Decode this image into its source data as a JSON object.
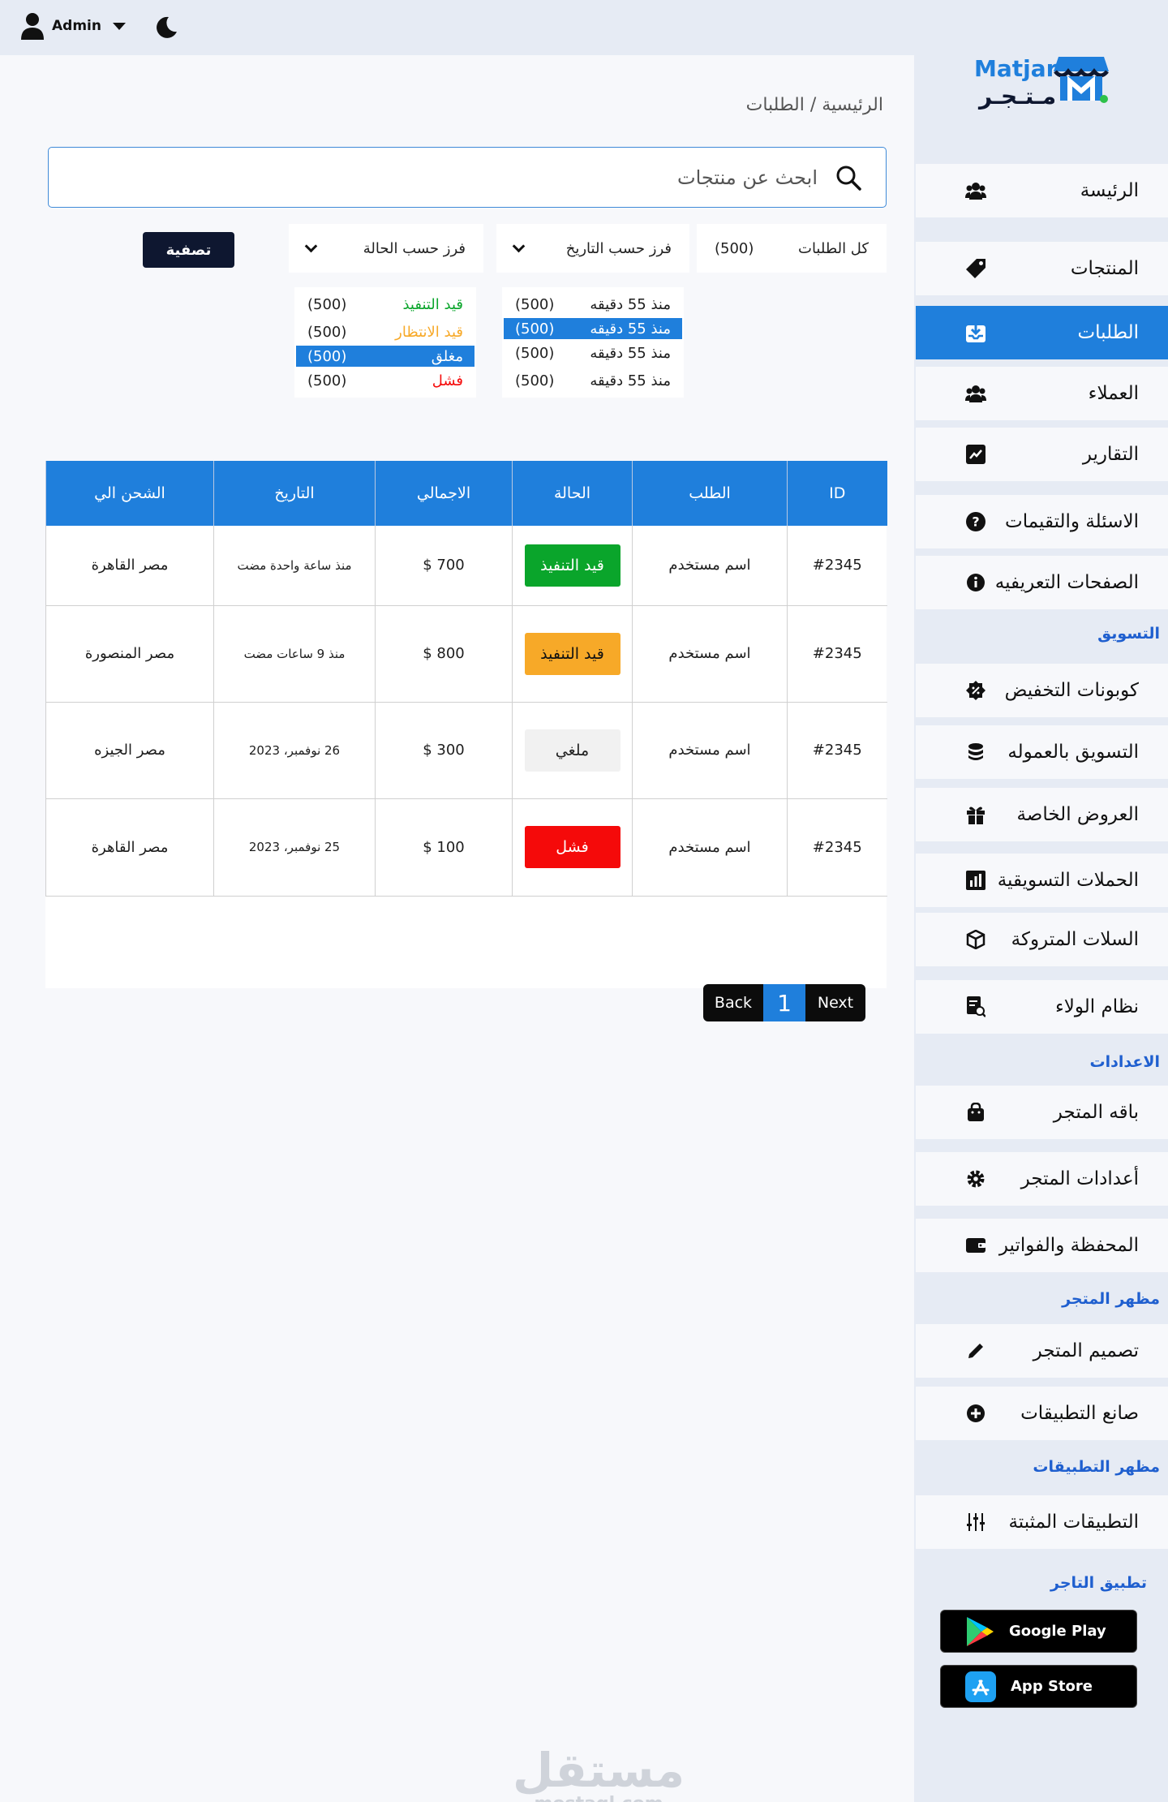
{
  "topbar": {
    "user_name": "Admin"
  },
  "breadcrumb": "الرئيسية / الطلبات",
  "search": {
    "placeholder": "ابحث عن منتجات"
  },
  "filters": {
    "all_orders_label": "كل الطلبات",
    "all_orders_count": "(500)",
    "sort_by_date_label": "فرز حسب  التاريخ",
    "sort_by_status_label": "فرز حسب الحالة",
    "filter_button": "تصفية"
  },
  "date_options": [
    {
      "label": "منذ 55 دقيقه",
      "count": "(500)"
    },
    {
      "label": "منذ 55 دقيقه",
      "count": "(500)"
    },
    {
      "label": "منذ 55 دقيقه",
      "count": "(500)"
    },
    {
      "label": "منذ 55 دقيقه",
      "count": "(500)"
    }
  ],
  "status_options": [
    {
      "label": "قيد التنفيذ",
      "count": "(500)"
    },
    {
      "label": "قيد الانتظار",
      "count": "(500)"
    },
    {
      "label": "مغلق",
      "count": "(500)"
    },
    {
      "label": "فشل",
      "count": "(500)"
    }
  ],
  "table": {
    "headers": [
      "ID",
      "الطلب",
      "الحالة",
      "الاجمالي",
      "التاريخ",
      "الشحن الي"
    ],
    "rows": [
      {
        "id": "#2345",
        "order": "اسم مستخدم",
        "status": "قيد التنفيذ",
        "total": "700 $",
        "date": "منذ ساعة واحدة مضت",
        "ship": "مصر  القاهرة"
      },
      {
        "id": "#2345",
        "order": "اسم مستخدم",
        "status": "قيد التنفيذ",
        "total": "800 $",
        "date": "منذ 9 ساعات مضت",
        "ship": "مصر  المنصورة"
      },
      {
        "id": "#2345",
        "order": "اسم مستخدم",
        "status": "ملغي",
        "total": "300 $",
        "date": "26 نوفمبر، 2023",
        "ship": "مصر  الجيزه"
      },
      {
        "id": "#2345",
        "order": "اسم مستخدم",
        "status": "فشل",
        "total": "100 $",
        "date": "25 نوفمبر، 2023",
        "ship": "مصر  القاهرة"
      }
    ]
  },
  "pagination": {
    "back": "Back",
    "page": "1",
    "next": "Next"
  },
  "watermark": {
    "ar": "مستقل",
    "en": "mostaql.com"
  },
  "sidebar": {
    "logo_en": "Matjar",
    "logo_ar": "مـتـجـر",
    "items": {
      "home": "الرئيسة",
      "products": "المنتجات",
      "orders": "الطلبات",
      "customers": "العملاء",
      "reports": "التقارير",
      "questions": "الاسئلة والتقيمات",
      "pages": "الصفحات التعريفيه",
      "coupons": "كوبونات التخفيض",
      "affiliate": "التسويق بالعموله",
      "offers": "العروض الخاصة",
      "campaigns": "الحملات التسويقية",
      "abandoned": "السلات المتروكة",
      "loyalty": "نظام الولاء",
      "package": "باقه المتجر",
      "store_settings": "أعدادات المتجر",
      "wallet": "المحفظة والفواتير",
      "design": "تصميم المتجر",
      "app_maker": "صانع التطبيقات",
      "installed_apps": "التطبيقات المثبتة"
    },
    "sections": {
      "marketing": "التسويق",
      "settings": "الاعدادات",
      "appearance": "مظهر المتجر",
      "apps_appearance": "مظهر التطبيقات",
      "merchant_app": "تطبيق التاجر"
    },
    "google_play": "Google Play",
    "app_store": "App Store"
  },
  "colors": {
    "primary": "#1f7fdc",
    "dark": "#0e1730",
    "in_progress": "#0aa52b",
    "pending": "#f7a928",
    "cancelled": "#f1f1f1",
    "failed": "#f50a0a"
  }
}
